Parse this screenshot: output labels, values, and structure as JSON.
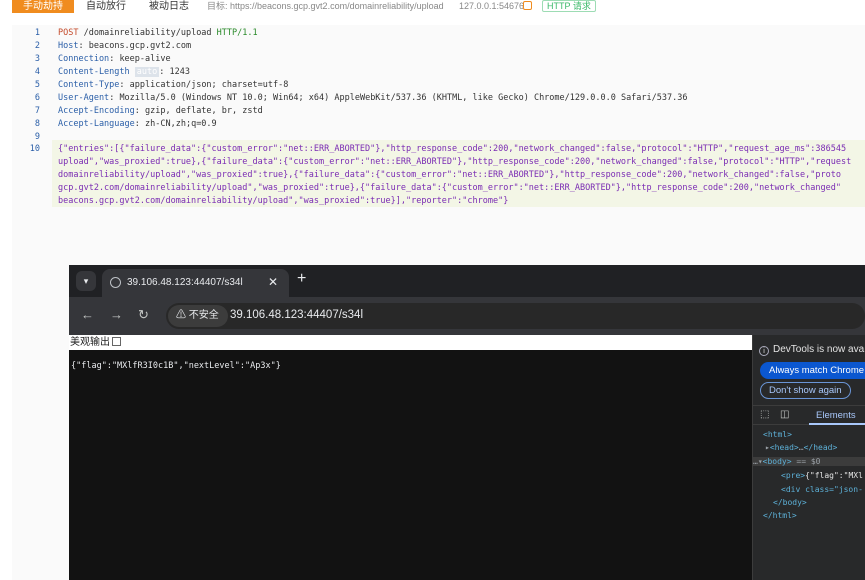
{
  "topbar": {
    "manual_button": "手动劫持",
    "auto_release": "自动放行",
    "passive_log": "被动日志",
    "target_label": "目标: https://beacons.gcp.gvt2.com/domainreliability/upload",
    "address": "127.0.0.1:54676",
    "badge": "HTTP 请求"
  },
  "request": {
    "line_numbers": [
      "1",
      "2",
      "3",
      "4",
      "5",
      "6",
      "7",
      "8",
      "9",
      "10"
    ],
    "method": "POST",
    "path": "/domainreliability/upload",
    "version": "HTTP/1.1",
    "headers": [
      {
        "name": "Host",
        "value": "beacons.gcp.gvt2.com"
      },
      {
        "name": "Connection",
        "value": "keep-alive"
      },
      {
        "name": "Content-Length",
        "hint": "auto",
        "value": "1243"
      },
      {
        "name": "Content-Type",
        "value": "application/json; charset=utf-8"
      },
      {
        "name": "User-Agent",
        "value": "Mozilla/5.0 (Windows NT 10.0; Win64; x64) AppleWebKit/537.36 (KHTML, like Gecko) Chrome/129.0.0.0 Safari/537.36"
      },
      {
        "name": "Accept-Encoding",
        "value": "gzip, deflate, br, zstd"
      },
      {
        "name": "Accept-Language",
        "value": "zh-CN,zh;q=0.9"
      }
    ],
    "body_lines": [
      "{\"entries\":[{\"failure_data\":{\"custom_error\":\"net::ERR_ABORTED\"},\"http_response_code\":200,\"network_changed\":false,\"protocol\":\"HTTP\",\"request_age_ms\":386545",
      "upload\",\"was_proxied\":true},{\"failure_data\":{\"custom_error\":\"net::ERR_ABORTED\"},\"http_response_code\":200,\"network_changed\":false,\"protocol\":\"HTTP\",\"request",
      "domainreliability/upload\",\"was_proxied\":true},{\"failure_data\":{\"custom_error\":\"net::ERR_ABORTED\"},\"http_response_code\":200,\"network_changed\":false,\"proto",
      "gcp.gvt2.com/domainreliability/upload\",\"was_proxied\":true},{\"failure_data\":{\"custom_error\":\"net::ERR_ABORTED\"},\"http_response_code\":200,\"network_changed\"",
      "beacons.gcp.gvt2.com/domainreliability/upload\",\"was_proxied\":true}],\"reporter\":\"chrome\"}"
    ]
  },
  "browser": {
    "tab_title": "39.106.48.123:44407/s34l",
    "insecure_label": "不安全",
    "url": "39.106.48.123:44407/s34l",
    "pretty_print_label": "美观输出",
    "body_text": "{\"flag\":\"MXlfR3I0c1B\",\"nextLevel\":\"Ap3x\"}"
  },
  "devtools": {
    "info": "DevTools is now ava",
    "primary_button": "Always match Chrome",
    "secondary_button": "Don't show again",
    "elements_tab": "Elements",
    "dom": {
      "html_open": "<html>",
      "head": "<head>",
      "head_ellipsis": "…",
      "head_close": "</head>",
      "body_prefix": "…",
      "body_open": "<body>",
      "body_eq": "== $0",
      "pre_open": "<pre>",
      "pre_text": "{\"flag\":\"MXl",
      "div_open": "<div class=\"json-",
      "body_close": "</body>",
      "html_close": "</html>"
    }
  }
}
